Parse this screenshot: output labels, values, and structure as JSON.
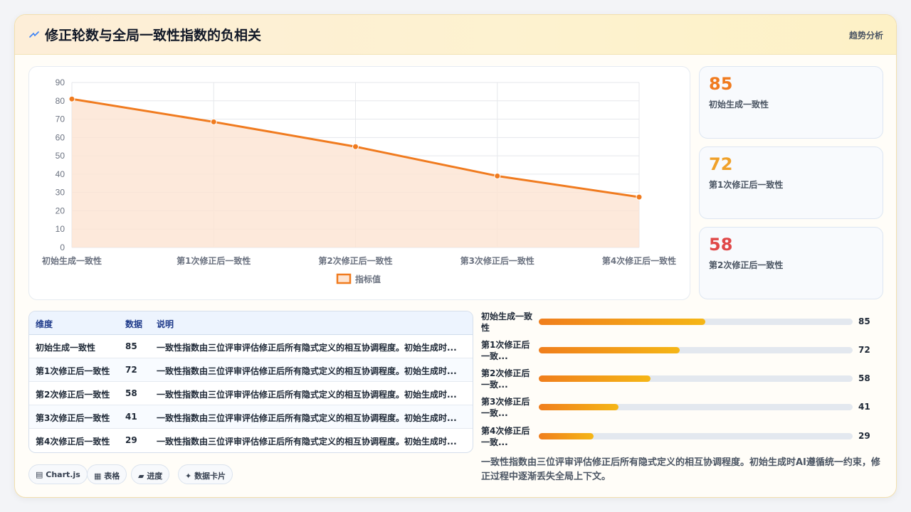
{
  "header": {
    "title": "修正轮数与全局一致性指数的负相关",
    "tag": "趋势分析",
    "icon": "lightning-icon"
  },
  "chart_data": {
    "type": "area",
    "categories": [
      "初始生成一致性",
      "第1次修正后一致性",
      "第2次修正后一致性",
      "第3次修正后一致性",
      "第4次修正后一致性"
    ],
    "series": [
      {
        "name": "指标值",
        "values": [
          81,
          68.5,
          55,
          39,
          27.5
        ],
        "color": "#f07b1f"
      }
    ],
    "ylim": [
      0,
      90
    ],
    "yticks": [
      0,
      10,
      20,
      30,
      40,
      50,
      60,
      70,
      80,
      90
    ],
    "grid": true,
    "legend": "bottom",
    "fill_color": "#fde4d2"
  },
  "stats": [
    {
      "value": "85",
      "label": "初始生成一致性",
      "color": "#f07b1f"
    },
    {
      "value": "72",
      "label": "第1次修正后一致性",
      "color": "#f0a12a"
    },
    {
      "value": "58",
      "label": "第2次修正后一致性",
      "color": "#e04848"
    }
  ],
  "table": {
    "headers": [
      "维度",
      "数据",
      "说明"
    ],
    "rows": [
      [
        "初始生成一致性",
        "85",
        "一致性指数由三位评审评估修正后所有隐式定义的相互协调程度。初始生成时..."
      ],
      [
        "第1次修正后一致性",
        "72",
        "一致性指数由三位评审评估修正后所有隐式定义的相互协调程度。初始生成时..."
      ],
      [
        "第2次修正后一致性",
        "58",
        "一致性指数由三位评审评估修正后所有隐式定义的相互协调程度。初始生成时..."
      ],
      [
        "第3次修正后一致性",
        "41",
        "一致性指数由三位评审评估修正后所有隐式定义的相互协调程度。初始生成时..."
      ],
      [
        "第4次修正后一致性",
        "29",
        "一致性指数由三位评审评估修正后所有隐式定义的相互协调程度。初始生成时..."
      ]
    ]
  },
  "bars": [
    {
      "label": "初始生成一致性",
      "value": "85",
      "fraction": 0.53
    },
    {
      "label": "第1次修正后一致...",
      "value": "72",
      "fraction": 0.45
    },
    {
      "label": "第2次修正后一致...",
      "value": "58",
      "fraction": 0.355
    },
    {
      "label": "第3次修正后一致...",
      "value": "41",
      "fraction": 0.255
    },
    {
      "label": "第4次修正后一致...",
      "value": "29",
      "fraction": 0.175
    }
  ],
  "pills": [
    {
      "icon": "chart-icon",
      "label": "Chart.js"
    },
    {
      "icon": "table-icon",
      "label": "表格"
    },
    {
      "icon": "progress-icon",
      "label": "进度"
    },
    {
      "icon": "sparkle-icon",
      "label": "数据卡片"
    }
  ],
  "note": "一致性指数由三位评审评估修正后所有隐式定义的相互协调程度。初始生成时AI遵循统一约束，修正过程中逐渐丢失全局上下文。"
}
